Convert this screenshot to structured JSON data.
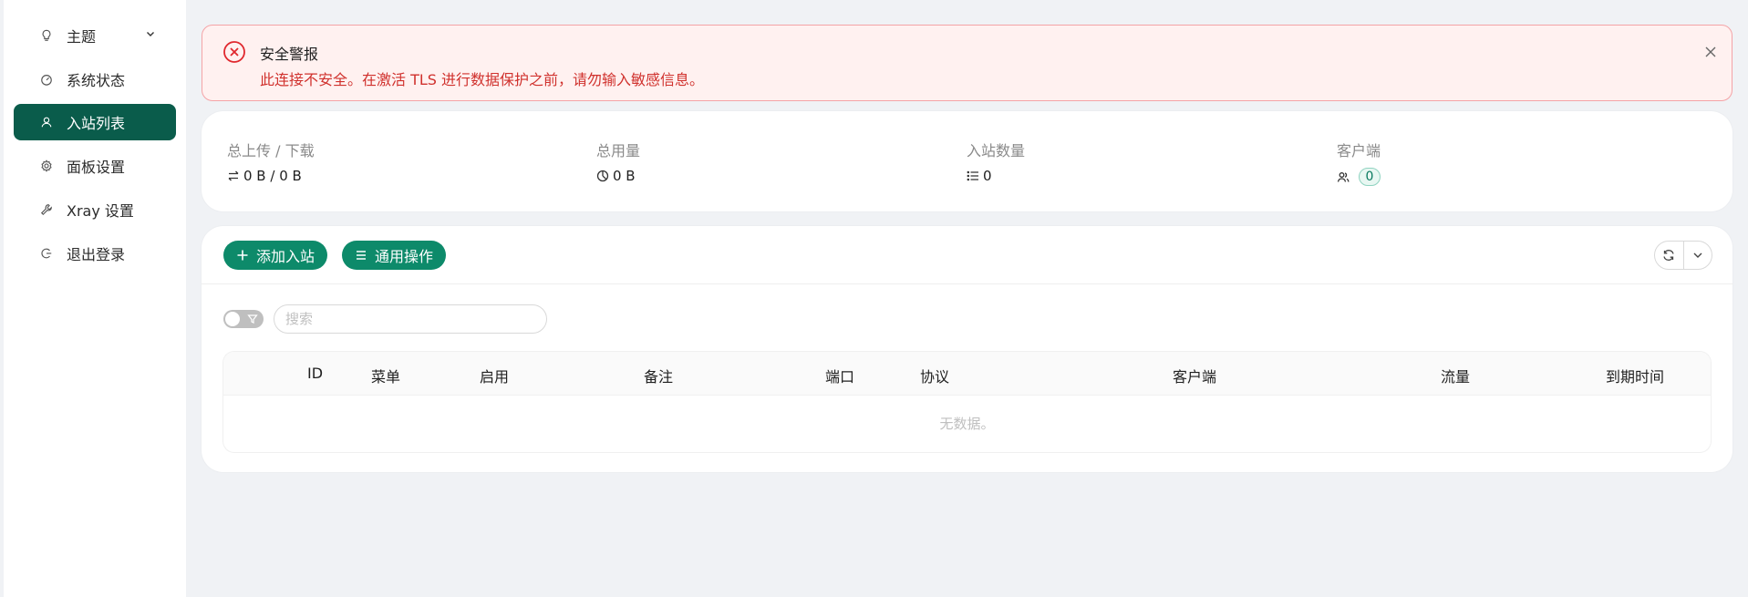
{
  "sidebar": {
    "items": [
      {
        "label": "主题",
        "icon": "bulb-icon"
      },
      {
        "label": "系统状态",
        "icon": "dashboard-icon"
      },
      {
        "label": "入站列表",
        "icon": "user-icon",
        "active": true
      },
      {
        "label": "面板设置",
        "icon": "gear-icon"
      },
      {
        "label": "Xray 设置",
        "icon": "tool-icon"
      },
      {
        "label": "退出登录",
        "icon": "logout-icon"
      }
    ]
  },
  "alert": {
    "title": "安全警报",
    "description": "此连接不安全。在激活 TLS 进行数据保护之前，请勿输入敏感信息。"
  },
  "stats": {
    "traffic": {
      "label": "总上传 / 下载",
      "value": "0 B / 0 B"
    },
    "usage": {
      "label": "总用量",
      "value": "0 B"
    },
    "inbounds": {
      "label": "入站数量",
      "value": "0"
    },
    "clients": {
      "label": "客户端",
      "value": "0"
    }
  },
  "toolbar": {
    "add_label": "添加入站",
    "general_label": "通用操作"
  },
  "search": {
    "placeholder": "搜索",
    "value": ""
  },
  "table": {
    "columns": [
      "ID",
      "菜单",
      "启用",
      "备注",
      "端口",
      "协议",
      "客户端",
      "流量",
      "到期时间"
    ],
    "rows": [],
    "empty_text": "无数据。"
  },
  "colors": {
    "accent": "#0d8a6a",
    "sidebar_active": "#0a5c4b",
    "alert_bg": "#fff1f0",
    "alert_border": "#f4a3a6",
    "alert_text": "#d0312d"
  }
}
